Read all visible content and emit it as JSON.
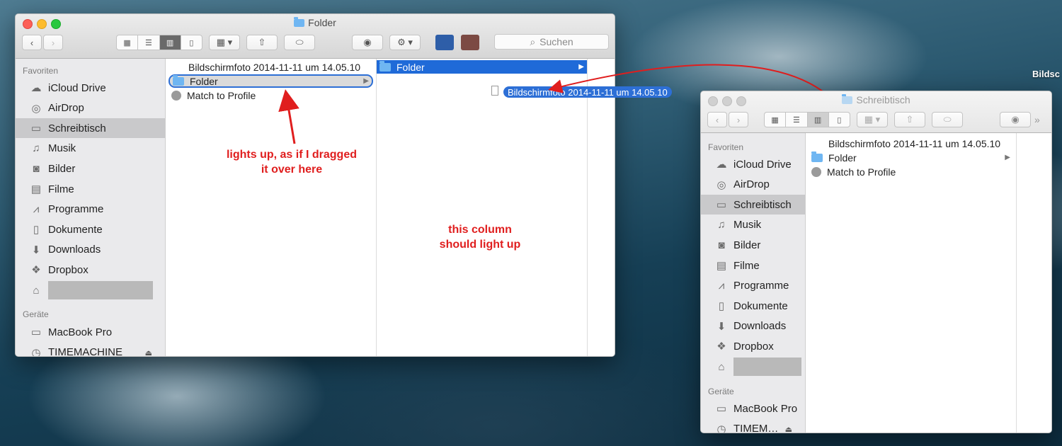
{
  "desktop": {
    "partial_label": "Bildsc"
  },
  "window_main": {
    "title": "Folder",
    "search_placeholder": "Suchen",
    "sidebar": {
      "favorites_header": "Favoriten",
      "devices_header": "Geräte",
      "items": [
        {
          "label": "iCloud Drive",
          "icon": "cloud-icon"
        },
        {
          "label": "AirDrop",
          "icon": "airdrop-icon"
        },
        {
          "label": "Schreibtisch",
          "icon": "desktop-icon",
          "selected": true
        },
        {
          "label": "Musik",
          "icon": "music-note-icon"
        },
        {
          "label": "Bilder",
          "icon": "camera-icon"
        },
        {
          "label": "Filme",
          "icon": "film-icon"
        },
        {
          "label": "Programme",
          "icon": "apps-icon"
        },
        {
          "label": "Dokumente",
          "icon": "document-icon"
        },
        {
          "label": "Downloads",
          "icon": "download-icon"
        },
        {
          "label": "Dropbox",
          "icon": "dropbox-icon"
        }
      ],
      "devices": [
        {
          "label": "MacBook Pro",
          "icon": "laptop-icon"
        },
        {
          "label": "TIMEMACHINE",
          "icon": "timemachine-icon"
        }
      ]
    },
    "column1": [
      {
        "label": "Bildschirmfoto 2014-11-11 um 14.05.10",
        "icon": "screenshot"
      },
      {
        "label": "Folder",
        "icon": "folder",
        "state": "drop-target-outline"
      },
      {
        "label": "Match to Profile",
        "icon": "tool"
      }
    ],
    "column2_header": {
      "label": "Folder",
      "state": "selected"
    },
    "dragged_item": {
      "label": "Bildschirmfoto 2014-11-11 um 14.05.10"
    }
  },
  "annotations": {
    "first_line1": "lights up, as if I dragged",
    "first_line2": "it over here",
    "second_line1": "this column",
    "second_line2": "should light up"
  },
  "window_right": {
    "title": "Schreibtisch",
    "sidebar": {
      "favorites_header": "Favoriten",
      "devices_header": "Geräte",
      "items": [
        {
          "label": "iCloud Drive",
          "icon": "cloud-icon"
        },
        {
          "label": "AirDrop",
          "icon": "airdrop-icon"
        },
        {
          "label": "Schreibtisch",
          "icon": "desktop-icon",
          "selected": true
        },
        {
          "label": "Musik",
          "icon": "music-note-icon"
        },
        {
          "label": "Bilder",
          "icon": "camera-icon"
        },
        {
          "label": "Filme",
          "icon": "film-icon"
        },
        {
          "label": "Programme",
          "icon": "apps-icon"
        },
        {
          "label": "Dokumente",
          "icon": "document-icon"
        },
        {
          "label": "Downloads",
          "icon": "download-icon"
        },
        {
          "label": "Dropbox",
          "icon": "dropbox-icon"
        }
      ],
      "devices": [
        {
          "label": "MacBook Pro",
          "icon": "laptop-icon"
        },
        {
          "label": "TIMEM…",
          "icon": "timemachine-icon"
        }
      ]
    },
    "column1": [
      {
        "label": "Bildschirmfoto 2014-11-11 um 14.05.10",
        "icon": "screenshot"
      },
      {
        "label": "Folder",
        "icon": "folder"
      },
      {
        "label": "Match to Profile",
        "icon": "tool"
      }
    ]
  },
  "colors": {
    "selection_blue": "#1f6ad8",
    "annotation_red": "#e01e1e",
    "sidebar_bg": "#eaeaec"
  }
}
